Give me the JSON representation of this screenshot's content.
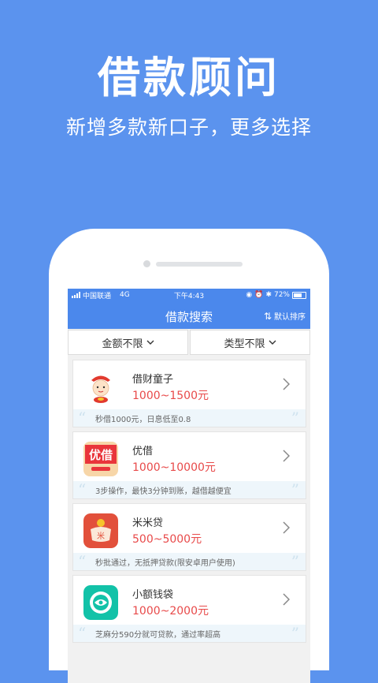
{
  "hero": {
    "title": "借款顾问",
    "subtitle": "新增多款新口子，更多选择"
  },
  "status_bar": {
    "carrier": "中国联通",
    "network": "4G",
    "time": "下午4:43",
    "battery": "72%",
    "battery_level": 0.72
  },
  "nav": {
    "title": "借款搜索",
    "sort_icon": "⇅",
    "sort_label": "默认排序"
  },
  "filters": [
    {
      "label": "金额不限"
    },
    {
      "label": "类型不限"
    }
  ],
  "loans": [
    {
      "name": "借财童子",
      "amount": "1000~1500元",
      "note": "秒借1000元，日息低至0.8",
      "logo": "cartoon-boy-logo"
    },
    {
      "name": "优借",
      "amount": "1000~10000元",
      "note": "3步操作，最快3分钟到账，越借越便宜",
      "logo_text": "优借",
      "logo": "youjie-logo"
    },
    {
      "name": "米米贷",
      "amount": "500~5000元",
      "note": "秒批通过，无抵押贷款(限安卓用户使用)",
      "logo_text": "米",
      "logo": "bag-logo"
    },
    {
      "name": "小额钱袋",
      "amount": "1000~2000元",
      "note": "芝麻分590分就可贷款，通过率超高",
      "logo": "eye-logo"
    }
  ],
  "colors": {
    "background": "#5b93ee",
    "header": "#4b88ec",
    "amount": "#e84a4a"
  }
}
